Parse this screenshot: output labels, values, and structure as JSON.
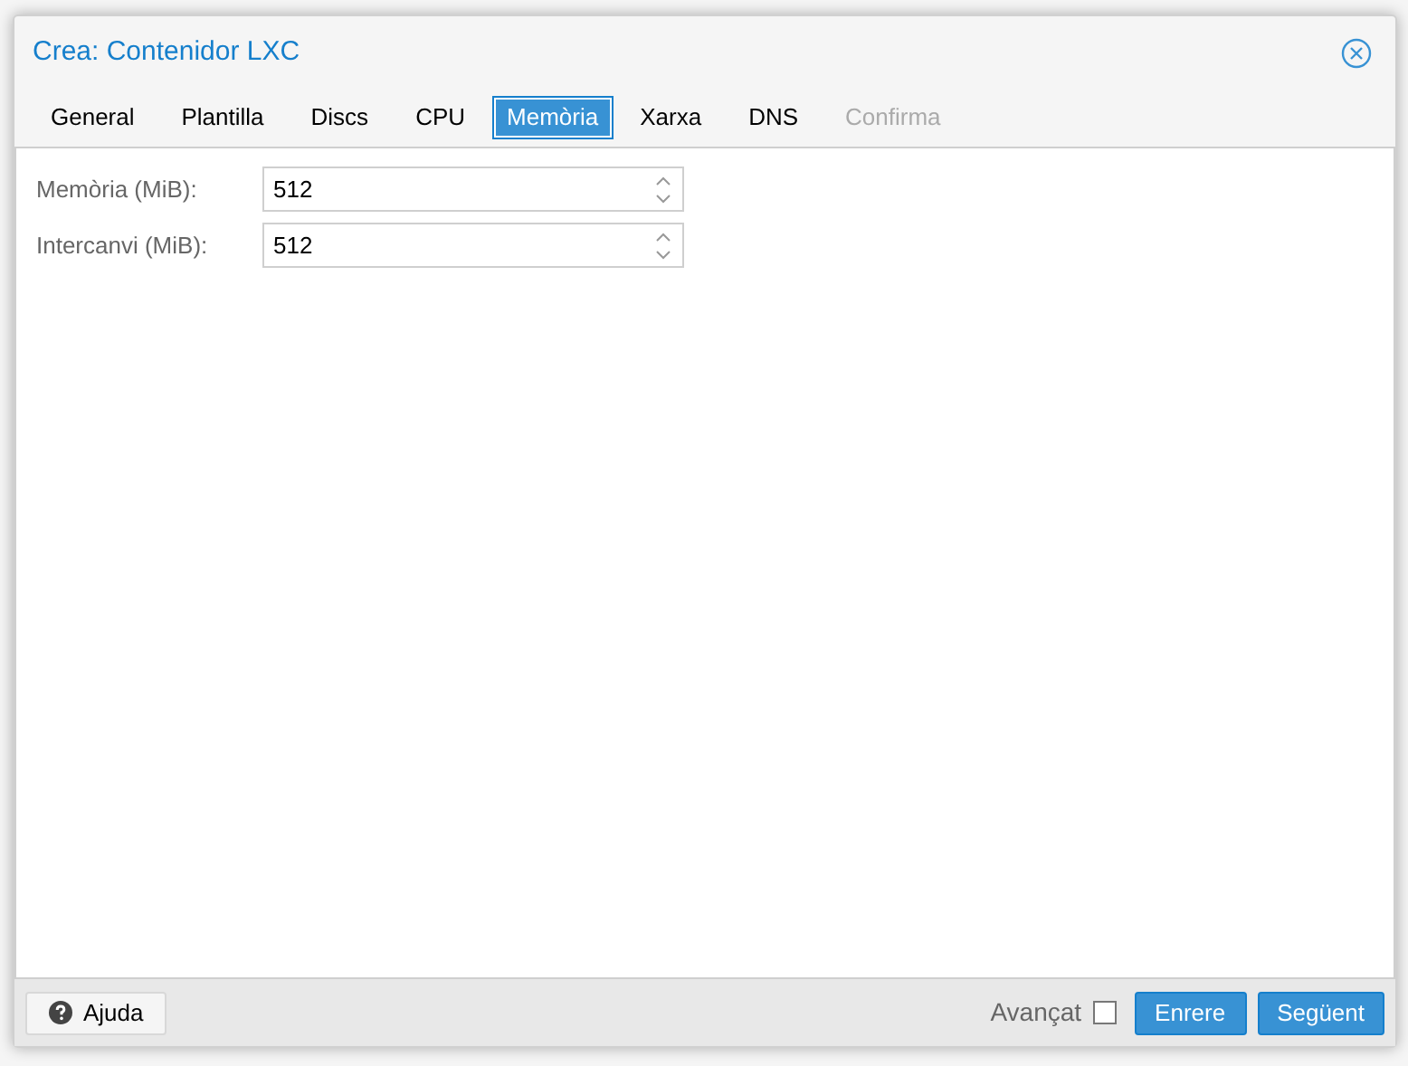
{
  "window": {
    "title": "Crea: Contenidor LXC"
  },
  "tabs": [
    {
      "label": "General",
      "selected": false,
      "disabled": false
    },
    {
      "label": "Plantilla",
      "selected": false,
      "disabled": false
    },
    {
      "label": "Discs",
      "selected": false,
      "disabled": false
    },
    {
      "label": "CPU",
      "selected": false,
      "disabled": false
    },
    {
      "label": "Memòria",
      "selected": true,
      "disabled": false
    },
    {
      "label": "Xarxa",
      "selected": false,
      "disabled": false
    },
    {
      "label": "DNS",
      "selected": false,
      "disabled": false
    },
    {
      "label": "Confirma",
      "selected": false,
      "disabled": true
    }
  ],
  "fields": [
    {
      "label": "Memòria (MiB):",
      "value": "512"
    },
    {
      "label": "Intercanvi (MiB):",
      "value": "512"
    }
  ],
  "footer": {
    "help_button": "Ajuda",
    "advanced": {
      "label": "Avançat",
      "checked": false
    },
    "buttons": [
      "Enrere",
      "Següent"
    ]
  }
}
